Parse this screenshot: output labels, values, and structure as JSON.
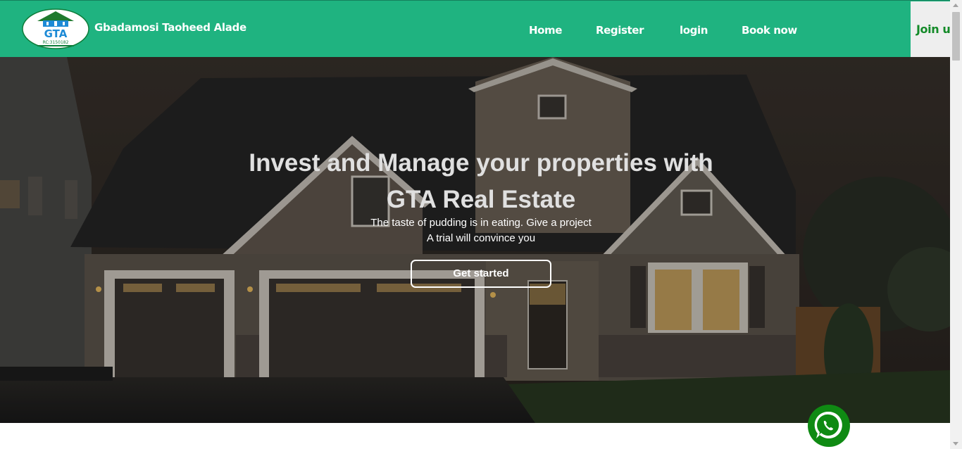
{
  "brand": {
    "name": "Gbadamosi Taoheed Alade",
    "logo_text": "GTA",
    "logo_rc": "RC:3150182"
  },
  "nav": {
    "items": [
      "Home",
      "Register",
      "login",
      "Book now"
    ],
    "join_label": "Join u"
  },
  "hero": {
    "title_line1": "Invest and Manage your properties with",
    "title_line2": "GTA Real Estate",
    "sub_line1": "The taste of pudding is in eating. Give a project",
    "sub_line2": "A trial will convince you",
    "cta_label": "Get started"
  },
  "colors": {
    "nav_bg": "#1fb380",
    "join_text": "#138a28",
    "whatsapp": "#0f8a13"
  },
  "icons": {
    "whatsapp": "whatsapp-icon",
    "logo": "gta-logo-icon"
  }
}
